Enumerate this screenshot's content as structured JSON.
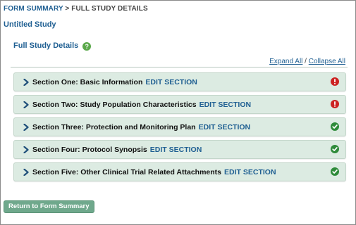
{
  "breadcrumb": {
    "link": "FORM SUMMARY",
    "separator": ">",
    "current": "FULL STUDY DETAILS"
  },
  "study_title": "Untitled Study",
  "page_title": "Full Study Details",
  "help_icon": "?",
  "expand_all": "Expand All",
  "link_separator": "/",
  "collapse_all": "Collapse All",
  "sections": [
    {
      "label": "Section One: Basic Information",
      "edit": "EDIT SECTION",
      "status": "error"
    },
    {
      "label": "Section Two: Study Population Characteristics",
      "edit": "EDIT SECTION",
      "status": "error"
    },
    {
      "label": "Section Three: Protection and Monitoring Plan",
      "edit": "EDIT SECTION",
      "status": "complete"
    },
    {
      "label": "Section Four: Protocol Synopsis",
      "edit": "EDIT SECTION",
      "status": "complete"
    },
    {
      "label": "Section Five: Other Clinical Trial Related Attachments",
      "edit": "EDIT SECTION",
      "status": "complete"
    }
  ],
  "return_button": "Return to Form Summary",
  "colors": {
    "link": "#1f5f92",
    "section_bg": "#dcebe2",
    "error": "#cc2222",
    "complete": "#2e8b3a",
    "button": "#6fa88c"
  },
  "icons": {
    "chevron": "chevron-right-icon",
    "error": "error-icon",
    "complete": "check-circle-icon",
    "help": "help-icon"
  }
}
